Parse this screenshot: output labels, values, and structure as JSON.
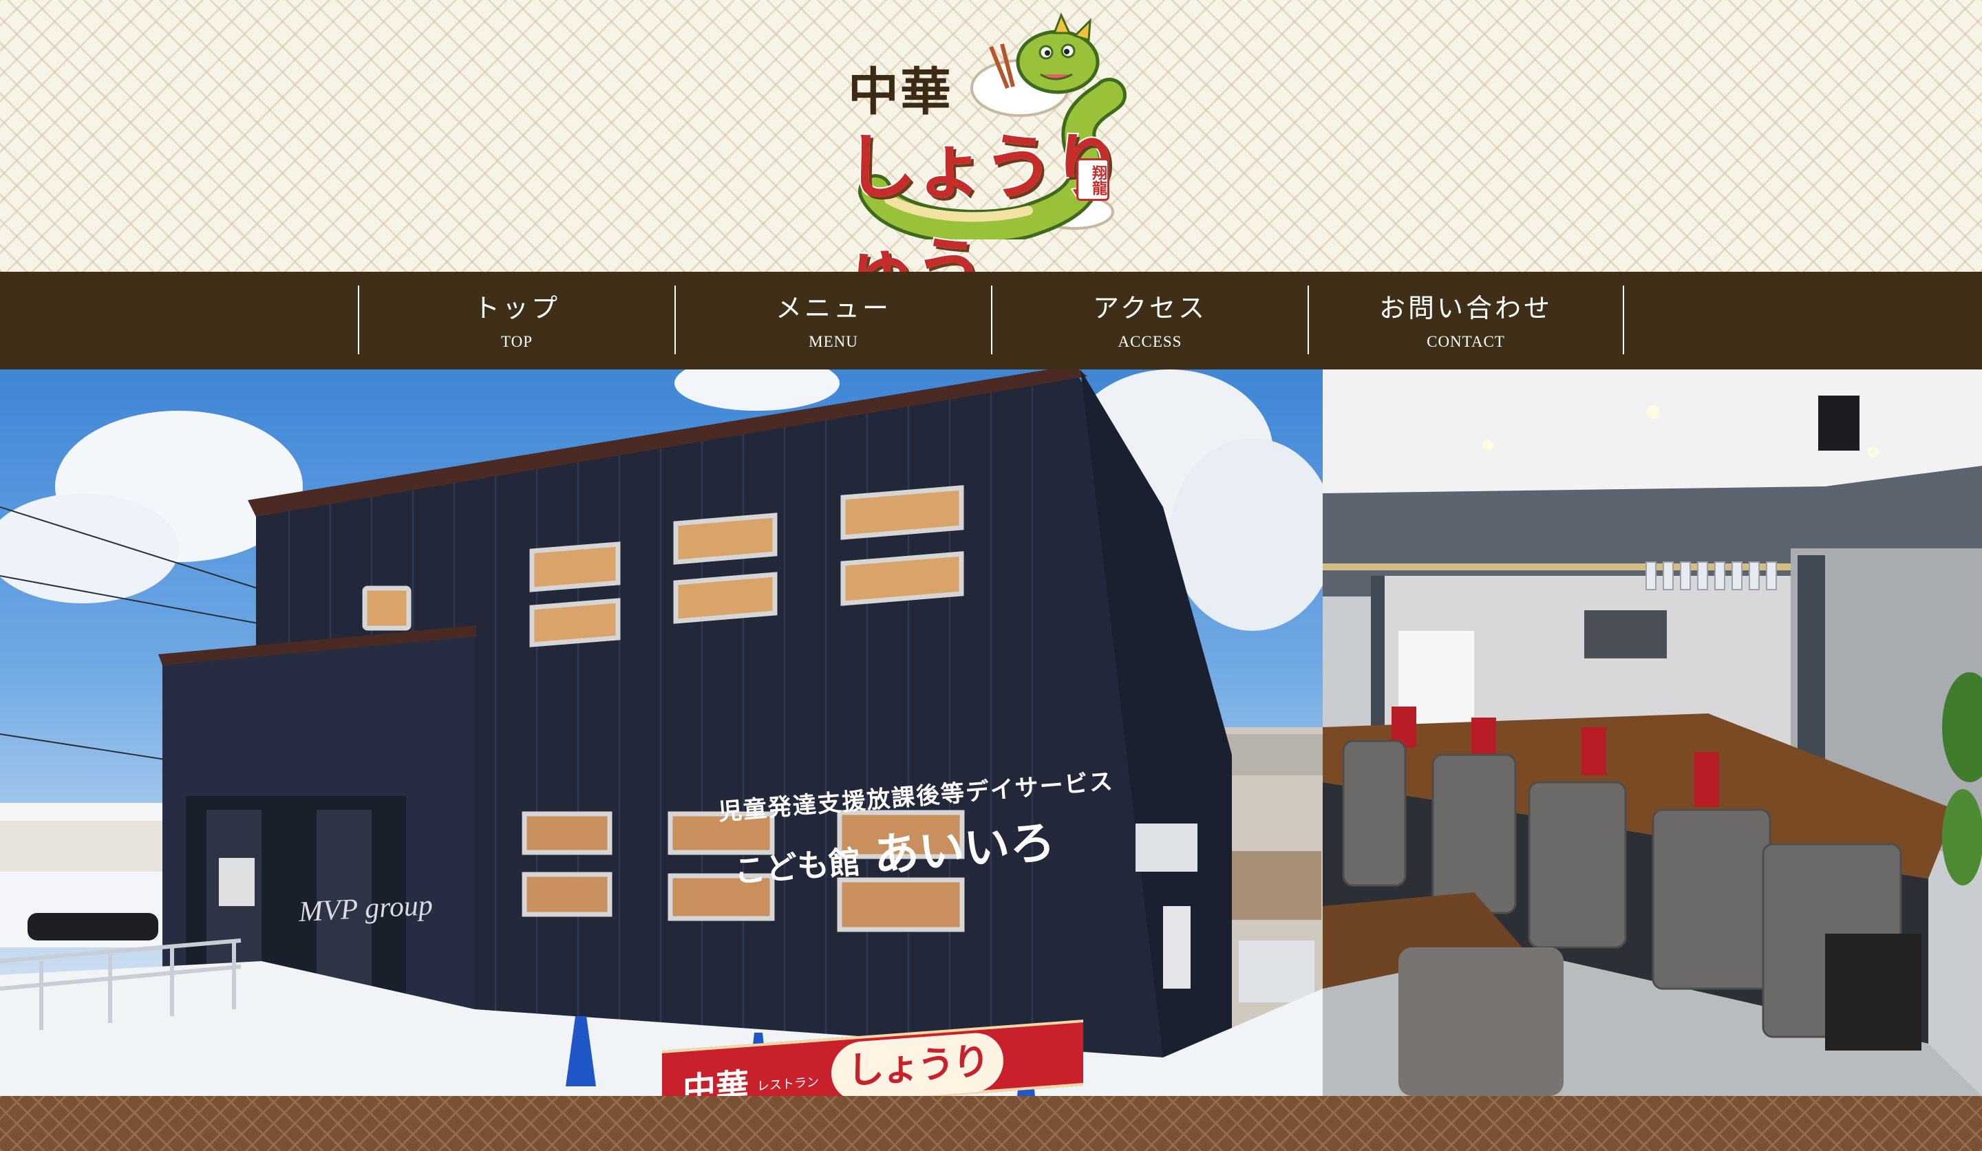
{
  "logo": {
    "top_text": "中華",
    "main_text": "しょうりゅう",
    "stamp_text": "翔龍"
  },
  "nav": {
    "items": [
      {
        "jp": "トップ",
        "en": "TOP"
      },
      {
        "jp": "メニュー",
        "en": "MENU"
      },
      {
        "jp": "アクセス",
        "en": "ACCESS"
      },
      {
        "jp": "お問い合わせ",
        "en": "CONTACT"
      }
    ]
  },
  "hero": {
    "building_sign_line1": "児童発達支援放課後等デイサービス",
    "building_sign_line2_prefix": "こども館",
    "building_sign_line2_name": "あいいろ",
    "building_logo": "MVP group",
    "banner": {
      "chuka": "中華",
      "sub": "レストラン",
      "main": "しょうりゅう"
    }
  },
  "colors": {
    "nav_bg": "#3f2f18",
    "accent_red": "#c62d2a",
    "header_bg": "#f8f3e7",
    "footer_bg": "#7a5233"
  }
}
